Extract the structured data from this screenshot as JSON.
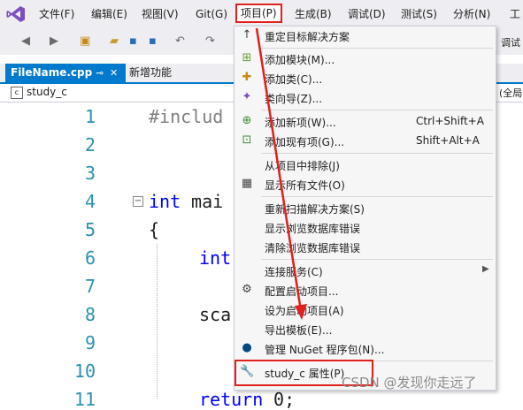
{
  "menubar": {
    "items": [
      "文件(F)",
      "编辑(E)",
      "视图(V)",
      "Git(G)",
      "项目(P)",
      "生成(B)",
      "调试(D)",
      "测试(S)",
      "分析(N)",
      "工"
    ]
  },
  "toolbar": {
    "right_text": "调试"
  },
  "tabs": [
    {
      "label": "FileName.cpp"
    },
    {
      "label": "新增功能"
    }
  ],
  "navbar": {
    "project": "study_c",
    "right_text": "(全局"
  },
  "editor": {
    "line_numbers": [
      "1",
      "2",
      "3",
      "4",
      "5",
      "6",
      "7",
      "8",
      "9",
      "10",
      "11"
    ],
    "lines": {
      "l1": "#includ",
      "l4_kw": "int",
      "l4_rest": " mai",
      "l5": "{",
      "l6": "int",
      "l8": "sca",
      "l11_kw": "return",
      "l11_rest": " 0;"
    }
  },
  "project_menu": {
    "items": [
      {
        "icon": "up-arrow-icon",
        "label": "重定目标解决方案"
      },
      {
        "icon": "add-module-icon",
        "label": "添加模块(M)..."
      },
      {
        "icon": "add-class-icon",
        "label": "添加类(C)..."
      },
      {
        "icon": "class-wizard-icon",
        "label": "类向导(Z)..."
      },
      {
        "icon": "add-new-item-icon",
        "label": "添加新项(W)...",
        "shortcut": "Ctrl+Shift+A"
      },
      {
        "icon": "add-existing-item-icon",
        "label": "添加现有项(G)...",
        "shortcut": "Shift+Alt+A"
      },
      {
        "icon": "",
        "label": "从项目中排除(J)"
      },
      {
        "icon": "show-all-files-icon",
        "label": "显示所有文件(O)"
      },
      {
        "icon": "",
        "label": "重新扫描解决方案(S)"
      },
      {
        "icon": "",
        "label": "显示浏览数据库错误"
      },
      {
        "icon": "",
        "label": "清除浏览数据库错误"
      },
      {
        "icon": "",
        "label": "连接服务(C)"
      },
      {
        "icon": "gear-icon",
        "label": "配置启动项目..."
      },
      {
        "icon": "",
        "label": "设为启动项目(A)"
      },
      {
        "icon": "",
        "label": "导出模板(E)..."
      },
      {
        "icon": "nuget-icon",
        "label": "管理 NuGet 程序包(N)..."
      },
      {
        "icon": "wrench-icon",
        "label": "study_c 属性(P)"
      }
    ]
  },
  "watermark": "CSDN @发现你走远了",
  "colors": {
    "accent": "#007acc",
    "annotation_red": "#e0201c",
    "keyword": "#0000ff",
    "line_number": "#2b91af"
  }
}
